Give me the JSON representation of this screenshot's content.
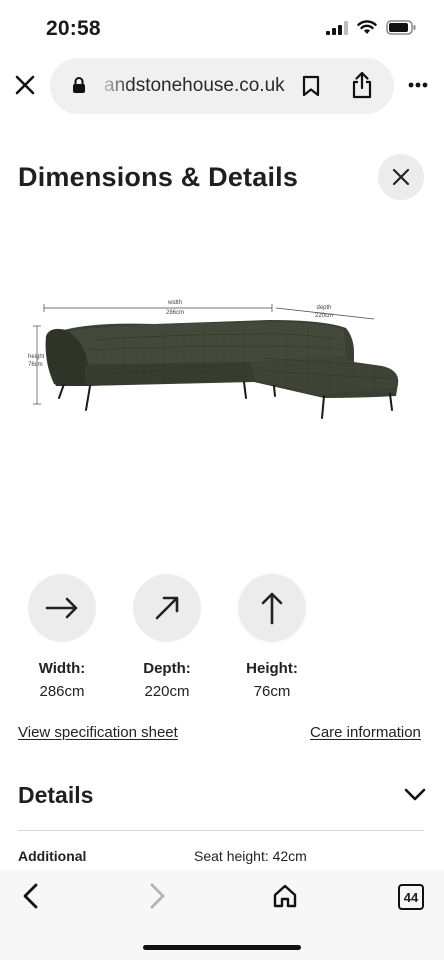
{
  "status": {
    "time": "20:58"
  },
  "browser": {
    "url": "andstonehouse.co.uk"
  },
  "page": {
    "title": "Dimensions & Details"
  },
  "figure": {
    "width_label": "width",
    "width_value": "286cm",
    "depth_label": "depth",
    "depth_value": "220cm",
    "height_label": "height",
    "height_value": "76cm"
  },
  "dimensions": [
    {
      "label": "Width:",
      "value": "286cm",
      "icon": "arrow-right-icon"
    },
    {
      "label": "Depth:",
      "value": "220cm",
      "icon": "arrow-up-right-icon"
    },
    {
      "label": "Height:",
      "value": "76cm",
      "icon": "arrow-up-icon"
    }
  ],
  "links": {
    "spec": "View specification sheet",
    "care": "Care information"
  },
  "details": {
    "heading": "Details",
    "rows": [
      {
        "key": "Additional",
        "value": "Seat height: 42cm"
      }
    ]
  },
  "toolbar": {
    "tabs_count": "44"
  },
  "colors": {
    "sofa": "#3a4032",
    "pill": "#f0f0f0",
    "circle": "#ececec"
  }
}
